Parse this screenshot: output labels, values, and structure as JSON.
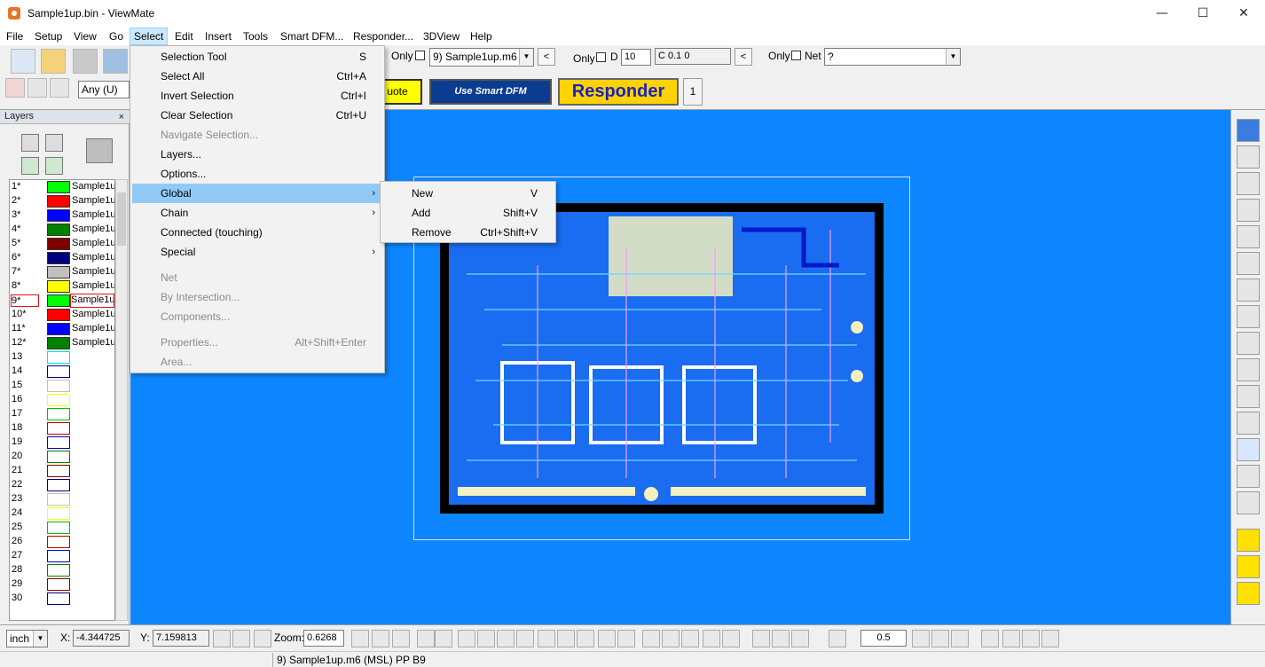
{
  "window": {
    "title": "Sample1up.bin - ViewMate",
    "minimize": "—",
    "maximize": "☐",
    "close": "✕"
  },
  "menubar": [
    "File",
    "Setup",
    "View",
    "Go",
    "Select",
    "Edit",
    "Insert",
    "Tools",
    "Smart DFM...",
    "Responder...",
    "3DView",
    "Help"
  ],
  "toolbar": {
    "only1": "Only",
    "layer_combo": "9) Sample1up.m6",
    "only2": "Only",
    "d_label": "D",
    "d_value": "10",
    "dcode_value": "C 0.1  0",
    "only3": "Only",
    "net_label": "Net",
    "net_value": "?",
    "any_combo": "Any   (U)",
    "quote_label": "uote",
    "smart_dfm_label": "Use Smart DFM",
    "responder_label": "Responder",
    "one_label": "1",
    "prev": "<"
  },
  "layers": {
    "title": "Layers",
    "close": "×",
    "rows": [
      {
        "num": "1*",
        "color": "#00ff00",
        "name": "Sample1u"
      },
      {
        "num": "2*",
        "color": "#ff0000",
        "name": "Sample1u"
      },
      {
        "num": "3*",
        "color": "#0000ff",
        "name": "Sample1u"
      },
      {
        "num": "4*",
        "color": "#008000",
        "name": "Sample1u"
      },
      {
        "num": "5*",
        "color": "#800000",
        "name": "Sample1u"
      },
      {
        "num": "6*",
        "color": "#000080",
        "name": "Sample1u"
      },
      {
        "num": "7*",
        "color": "#c0c0c0",
        "name": "Sample1u"
      },
      {
        "num": "8*",
        "color": "#ffff00",
        "name": "Sample1u"
      },
      {
        "num": "9*",
        "color": "#00ff00",
        "name": "Sample1u",
        "selected": true
      },
      {
        "num": "10*",
        "color": "#ff0000",
        "name": "Sample1u"
      },
      {
        "num": "11*",
        "color": "#0000ff",
        "name": "Sample1u"
      },
      {
        "num": "12*",
        "color": "#008000",
        "name": "Sample1u"
      },
      {
        "num": "13",
        "outline": "#00e0e0"
      },
      {
        "num": "14",
        "outline": "#000080"
      },
      {
        "num": "15",
        "outline": "#c0c0c0"
      },
      {
        "num": "16",
        "outline": "#ffff00"
      },
      {
        "num": "17",
        "outline": "#00c000"
      },
      {
        "num": "18",
        "outline": "#c00000"
      },
      {
        "num": "19",
        "outline": "#0000c0"
      },
      {
        "num": "20",
        "outline": "#008000"
      },
      {
        "num": "21",
        "outline": "#800000"
      },
      {
        "num": "22",
        "outline": "#000080"
      },
      {
        "num": "23",
        "outline": "#c0c0c0"
      },
      {
        "num": "24",
        "outline": "#ffff00"
      },
      {
        "num": "25",
        "outline": "#00c000"
      },
      {
        "num": "26",
        "outline": "#c00000"
      },
      {
        "num": "27",
        "outline": "#0000c0"
      },
      {
        "num": "28",
        "outline": "#008000"
      },
      {
        "num": "29",
        "outline": "#800000"
      },
      {
        "num": "30",
        "outline": "#000080"
      }
    ]
  },
  "select_menu": [
    {
      "label": "Selection Tool",
      "shortcut": "S"
    },
    {
      "label": "Select All",
      "shortcut": "Ctrl+A"
    },
    {
      "label": "Invert Selection",
      "shortcut": "Ctrl+I"
    },
    {
      "label": "Clear Selection",
      "shortcut": "Ctrl+U"
    },
    {
      "label": "Navigate Selection...",
      "disabled": true
    },
    {
      "label": "Layers..."
    },
    {
      "label": "Options..."
    },
    {
      "label": "Global",
      "submenu": true,
      "highlighted": true
    },
    {
      "label": "Chain",
      "submenu": true
    },
    {
      "label": "Connected (touching)"
    },
    {
      "label": "Special",
      "submenu": true
    },
    {
      "label": "Net",
      "disabled": true
    },
    {
      "label": "By Intersection...",
      "disabled": true
    },
    {
      "label": "Components...",
      "disabled": true
    },
    {
      "label": "Properties...",
      "shortcut": "Alt+Shift+Enter",
      "disabled": true
    },
    {
      "label": "Area...",
      "disabled": true
    }
  ],
  "global_menu": [
    {
      "label": "New",
      "shortcut": "V"
    },
    {
      "label": "Add",
      "shortcut": "Shift+V"
    },
    {
      "label": "Remove",
      "shortcut": "Ctrl+Shift+V"
    }
  ],
  "bottom": {
    "units": "inch",
    "x_label": "X:",
    "x_value": "-4.344725",
    "y_label": "Y:",
    "y_value": "7.159813",
    "zoom_label": "Zoom:",
    "zoom_value": "0.6268",
    "grid_value": "0.5"
  },
  "status": {
    "text": "9) Sample1up.m6 (MSL) PP B9"
  },
  "colors": {
    "canvas": "#0d86ff",
    "board": "#000000",
    "menu_highlight": "#91c9f7",
    "responder_bg": "#ffd200",
    "smart_dfm_bg": "#0a3d8f"
  }
}
